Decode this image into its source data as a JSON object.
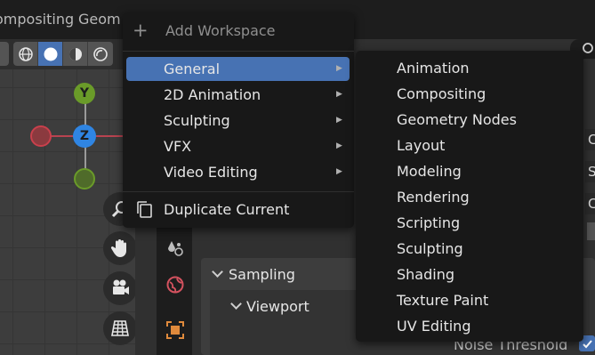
{
  "topbar": {
    "tabs": [
      "ompositing",
      "Geom"
    ]
  },
  "gizmo": {
    "y_label": "Y",
    "z_label": "Z",
    "colors": {
      "x": "#c9404c",
      "y": "#6a9b29",
      "z": "#2f85e3",
      "x_neg": "#8b3a3f",
      "y_neg": "#4f6b2a"
    }
  },
  "viewport": {
    "shading_modes": [
      "wireframe-icon",
      "solid-icon",
      "material-icon",
      "rendered-icon"
    ],
    "active_shading": "solid-icon",
    "nav_tools": [
      "zoom-icon",
      "hand-pan-icon",
      "camera-icon",
      "grid-icon"
    ]
  },
  "menu": {
    "plus": "+",
    "title": "Add Workspace",
    "items": [
      {
        "label": "General",
        "has_submenu": true,
        "highlighted": true
      },
      {
        "label": "2D Animation",
        "has_submenu": true
      },
      {
        "label": "Sculpting",
        "has_submenu": true
      },
      {
        "label": "VFX",
        "has_submenu": true
      },
      {
        "label": "Video Editing",
        "has_submenu": true
      }
    ],
    "duplicate": "Duplicate Current",
    "arrow": "▶"
  },
  "submenu": {
    "items": [
      "Animation",
      "Compositing",
      "Geometry Nodes",
      "Layout",
      "Modeling",
      "Rendering",
      "Scripting",
      "Sculpting",
      "Shading",
      "Texture Paint",
      "UV Editing"
    ]
  },
  "properties": {
    "sampling_label": "Sampling",
    "viewport_label": "Viewport",
    "noise_label": "Noise Threshold",
    "edge_letters": [
      "C",
      "S",
      "C"
    ],
    "accent": "#4772b3"
  }
}
